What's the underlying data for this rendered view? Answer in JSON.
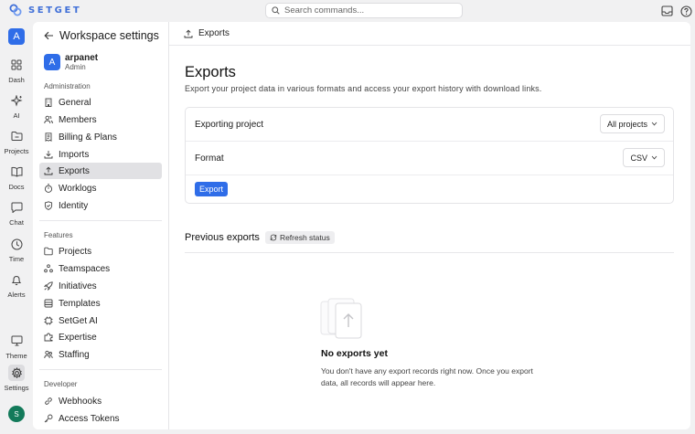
{
  "brand": {
    "name": "SETGET",
    "color": "#3f6fd8"
  },
  "search": {
    "placeholder": "Search commands..."
  },
  "top_icons": [
    "inbox-icon",
    "help-icon"
  ],
  "rail": {
    "workspace_initial": "A",
    "items": [
      {
        "label": "Dash",
        "icon": "dashboard-icon"
      },
      {
        "label": "AI",
        "icon": "sparkle-icon"
      },
      {
        "label": "Projects",
        "icon": "folder-icon"
      },
      {
        "label": "Docs",
        "icon": "book-icon"
      },
      {
        "label": "Chat",
        "icon": "chat-icon"
      },
      {
        "label": "Time",
        "icon": "clock-icon"
      },
      {
        "label": "Alerts",
        "icon": "bell-icon"
      },
      {
        "label": "Theme",
        "icon": "monitor-icon"
      },
      {
        "label": "Settings",
        "icon": "gear-icon",
        "active": true
      }
    ],
    "user_initial": "S"
  },
  "sidebar": {
    "title": "Workspace settings",
    "user": {
      "initial": "A",
      "name": "arpanet",
      "role": "Admin"
    },
    "sections": [
      {
        "title": "Administration",
        "items": [
          "General",
          "Members",
          "Billing & Plans",
          "Imports",
          "Exports",
          "Worklogs",
          "Identity"
        ]
      },
      {
        "title": "Features",
        "items": [
          "Projects",
          "Teamspaces",
          "Initiatives",
          "Templates",
          "SetGet AI",
          "Expertise",
          "Staffing"
        ]
      },
      {
        "title": "Developer",
        "items": [
          "Webhooks",
          "Access Tokens"
        ]
      }
    ],
    "active_item": "Exports"
  },
  "main": {
    "breadcrumb": "Exports",
    "title": "Exports",
    "description": "Export your project data in various formats and access your export history with download links.",
    "rows": [
      {
        "label": "Exporting project",
        "value": "All projects"
      },
      {
        "label": "Format",
        "value": "CSV"
      }
    ],
    "export_button": "Export",
    "previous": {
      "title": "Previous exports",
      "refresh": "Refresh status",
      "empty_title": "No exports yet",
      "empty_desc": "You don't have any export records right now. Once you export data, all records will appear here."
    }
  },
  "colors": {
    "accent": "#2f6de8",
    "avatar_green": "#137a5a"
  }
}
